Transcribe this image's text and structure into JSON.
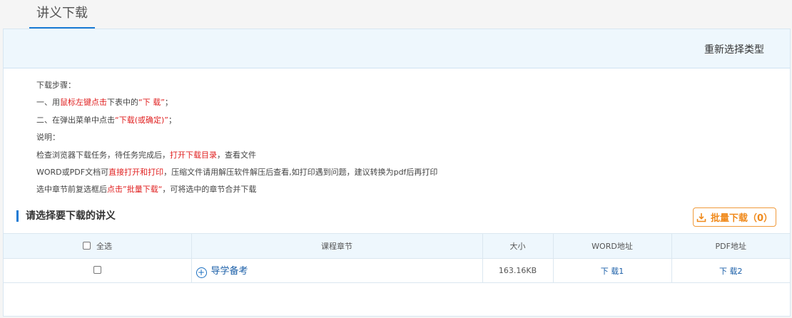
{
  "tabs": {
    "active": "讲义下载"
  },
  "header": {
    "reselect": "重新选择类型"
  },
  "instructions": {
    "title": "下载步骤：",
    "step1_prefix": "一、用",
    "step1_red": "鼠标左键点击",
    "step1_mid": "下表中的",
    "step1_quote": "“下 载”",
    "step1_suffix": "；",
    "step2_prefix": "二、在弹出菜单中点击",
    "step2_quote": "“下载(或确定)”",
    "step2_suffix": "；",
    "note_title": "说明：",
    "note1_prefix": "检查浏览器下载任务，待任务完成后，",
    "note1_red": "打开下载目录",
    "note1_suffix": "，查看文件",
    "note2_prefix": "WORD或PDF文档可",
    "note2_red": "直接打开和打印",
    "note2_suffix": "，压缩文件请用解压软件解压后查看,如打印遇到问题，建议转换为pdf后再打印",
    "note3_prefix": "选中章节前复选框后",
    "note3_red": "点击”批量下载“",
    "note3_suffix": "，可将选中的章节合并下载"
  },
  "section": {
    "title": "请选择要下载的讲义",
    "batch_button": "批量下载（0）"
  },
  "table": {
    "headers": {
      "select_all": "全选",
      "chapter": "课程章节",
      "size": "大小",
      "word": "WORD地址",
      "pdf": "PDF地址"
    },
    "rows": [
      {
        "chapter": "导学备考",
        "size": "163.16KB",
        "word": "下 载1",
        "pdf": "下 载2"
      }
    ]
  },
  "colors": {
    "accent": "#1b7bd4",
    "red": "#e02020",
    "orange": "#f08a1c"
  }
}
